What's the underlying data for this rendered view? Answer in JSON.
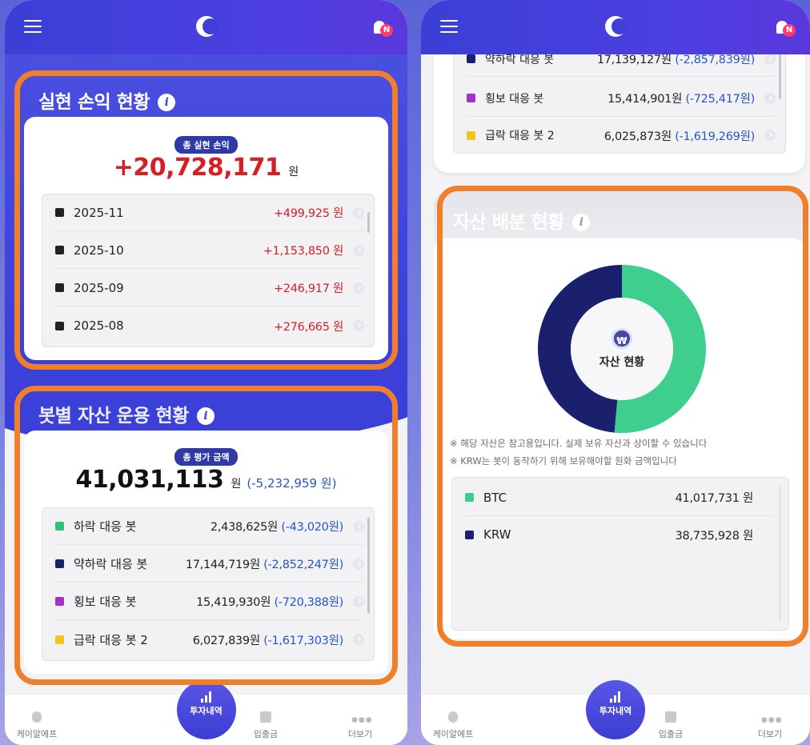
{
  "left": {
    "realized": {
      "title": "실현 손익 현황",
      "pill": "총 실현 손익",
      "total": "+20,728,171",
      "unit": "원",
      "rows": [
        {
          "label": "2025-11",
          "value": "+499,925 원"
        },
        {
          "label": "2025-10",
          "value": "+1,153,850 원"
        },
        {
          "label": "2025-09",
          "value": "+246,917 원"
        },
        {
          "label": "2025-08",
          "value": "+276,665 원"
        }
      ]
    },
    "bots": {
      "title": "봇별 자산 운용 현황",
      "pill": "총 평가 금액",
      "total": "41,031,113",
      "unit": "원",
      "diff": "(-5,232,959 원)",
      "rows": [
        {
          "label": "하락 대응 봇",
          "amount": "2,438,625원",
          "diff": "(-43,020원)",
          "color": "#2fc27a"
        },
        {
          "label": "약하락 대응 봇",
          "amount": "17,144,719원",
          "diff": "(-2,852,247원)",
          "color": "#1a1f6e"
        },
        {
          "label": "횡보 대응 봇",
          "amount": "15,419,930원",
          "diff": "(-720,388원)",
          "color": "#a42fc9"
        },
        {
          "label": "급락 대응 봇 2",
          "amount": "6,027,839원",
          "diff": "(-1,617,303원)",
          "color": "#f2c31b"
        }
      ]
    }
  },
  "right": {
    "top_rows": [
      {
        "label": "약하락 대응 봇",
        "amount": "17,139,127원",
        "diff": "(-2,857,839원)",
        "color": "#1a1f6e"
      },
      {
        "label": "횡보 대응 봇",
        "amount": "15,414,901원",
        "diff": "(-725,417원)",
        "color": "#a42fc9"
      },
      {
        "label": "급락 대응 봇 2",
        "amount": "6,025,873원",
        "diff": "(-1,619,269원)",
        "color": "#f2c31b"
      }
    ],
    "allocation": {
      "title": "자산 배분 현황",
      "center_label": "자산 현황",
      "note1": "※ 해당 자산은 참고용입니다. 실제 보유 자산과 상이할 수 있습니다",
      "note2": "※ KRW는 봇이 동작하기 위해 보유해야할 원화 금액입니다",
      "items": [
        {
          "label": "BTC",
          "value": "41,017,731 원",
          "color": "#3ecf8e"
        },
        {
          "label": "KRW",
          "value": "38,735,928 원",
          "color": "#1a1f6e"
        }
      ]
    }
  },
  "chart_data": {
    "type": "pie",
    "title": "자산 현황",
    "categories": [
      "BTC",
      "KRW"
    ],
    "values": [
      41017731,
      38735928
    ],
    "colors": [
      "#3ecf8e",
      "#1a1f6e"
    ]
  },
  "nav": {
    "items": [
      "케이알에프",
      "투자내역",
      "입출금",
      "더보기"
    ]
  }
}
